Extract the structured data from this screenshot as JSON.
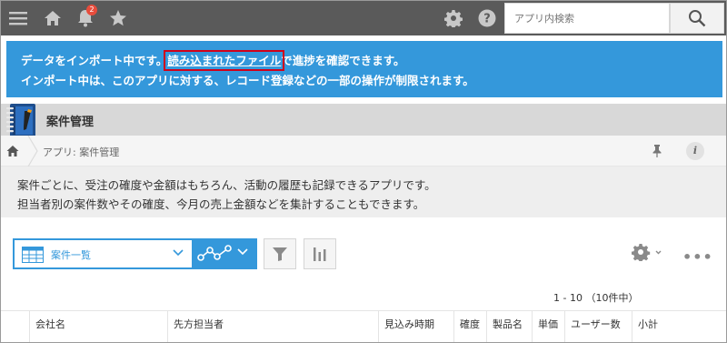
{
  "header": {
    "notification_count": "2",
    "search_placeholder": "アプリ内検索"
  },
  "notice": {
    "line1_before": "データをインポート中です。",
    "line1_link": "読み込まれたファイル",
    "line1_after": "で進捗を確認できます。",
    "line2": "インポート中は、このアプリに対する、レコード登録などの一部の操作が制限されます。"
  },
  "app": {
    "title": "案件管理",
    "breadcrumb": "アプリ: 案件管理",
    "description_line1": "案件ごとに、受注の確度や金額はもちろん、活動の履歴も記録できるアプリです。",
    "description_line2": "担当者別の案件数やその確度、今月の売上金額などを集計することもできます。"
  },
  "toolbar": {
    "view_label": "案件一覧",
    "pager": "1 - 10 （10件中）"
  },
  "table": {
    "columns": [
      "会社名",
      "先方担当者",
      "見込み時期",
      "確度",
      "製品名",
      "単価",
      "ユーザー数",
      "小計"
    ]
  },
  "colors": {
    "header_bg": "#5a5a5a",
    "accent_blue": "#3498db",
    "badge_red": "#e74c3c"
  }
}
